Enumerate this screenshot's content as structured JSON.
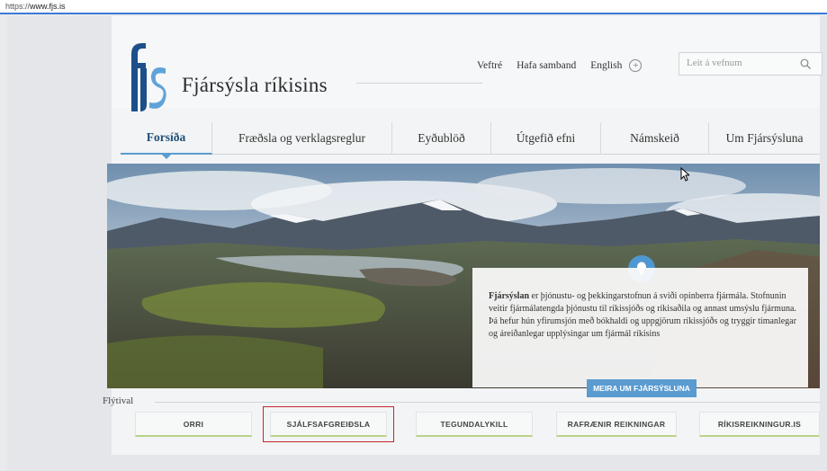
{
  "browser": {
    "url_prefix": "https://",
    "url_domain": "www.fjs.is"
  },
  "header": {
    "logo_text": "fjs",
    "site_name": "Fjársýsla ríkisins",
    "links": [
      "Veftré",
      "Hafa samband",
      "English"
    ],
    "search_placeholder": "Leit á vefnum"
  },
  "nav": {
    "items": [
      {
        "label": "Forsíða",
        "active": true
      },
      {
        "label": "Fræðsla og verklagsreglur"
      },
      {
        "label": "Eyðublöð"
      },
      {
        "label": "Útgefið efni"
      },
      {
        "label": "Námskeið"
      },
      {
        "label": "Um Fjársýsluna"
      }
    ]
  },
  "info": {
    "lead": "Fjársýslan",
    "body": " er þjónustu- og þekkingarstofnun á sviði opinberra fjármála. Stofnunin veitir fjármálatengda þjónustu til ríkissjóðs og ríkisaðila og annast umsýslu fjármuna. Þá hefur hún yfirumsjón með bókhaldi og uppgjörum ríkissjóðs og tryggir tímanlegar og áreiðanlegar upplýsingar um fjármál ríkisins",
    "button": "MEIRA UM FJÁRSÝSLUNA"
  },
  "quick": {
    "label": "Flýtival",
    "buttons": [
      "ORRI",
      "SJÁLFSAFGREIÐSLA",
      "TEGUNDALYKILL",
      "RAFRÆNIR REIKNINGAR",
      "RÍKISREIKNINGUR.IS"
    ]
  },
  "colors": {
    "accent": "#5a9bd0",
    "brand": "#1f4f7a",
    "highlight": "#c0282d",
    "button_underline": "#b9d48a"
  }
}
